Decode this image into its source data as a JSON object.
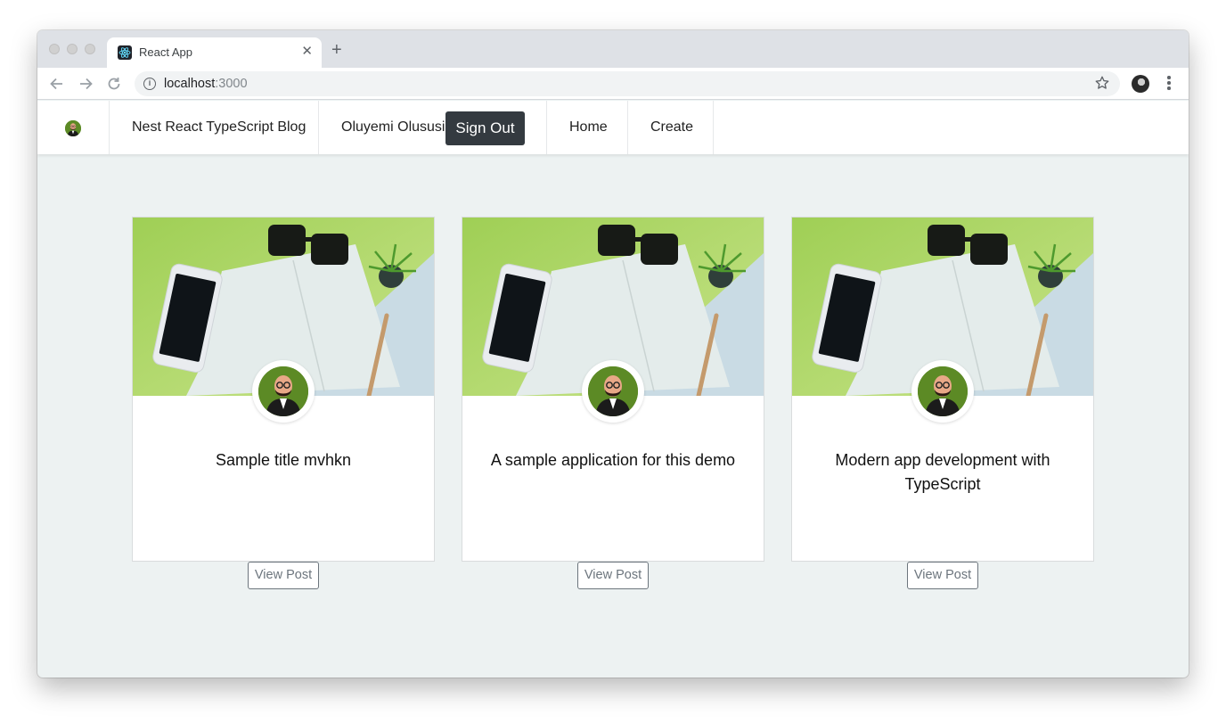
{
  "browser": {
    "tab_title": "React App",
    "url_host": "localhost",
    "url_port": ":3000"
  },
  "navbar": {
    "brand": "Nest React TypeScript Blog",
    "user_name": "Oluyemi Olususi",
    "sign_out_label": "Sign Out",
    "links": [
      "Home",
      "Create"
    ]
  },
  "posts": [
    {
      "title": "Sample title mvhkn",
      "button_label": "View Post"
    },
    {
      "title": "A sample application for this demo",
      "button_label": "View Post"
    },
    {
      "title": "Modern app development with TypeScript",
      "button_label": "View Post"
    }
  ],
  "colors": {
    "page_bg": "#edf2f2",
    "sign_out_bg": "#343a40",
    "outline_button": "#6c757d"
  }
}
